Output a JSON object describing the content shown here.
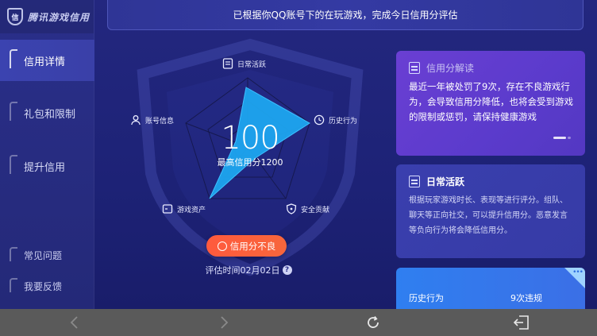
{
  "brand": {
    "name": "腾讯游戏信用",
    "logo_text": "信"
  },
  "sidebar": {
    "items": [
      {
        "label": "信用详情",
        "active": true
      },
      {
        "label": "礼包和限制",
        "active": false
      },
      {
        "label": "提升信用",
        "active": false
      }
    ],
    "bottom_items": [
      {
        "label": "常见问题"
      },
      {
        "label": "我要反馈"
      }
    ]
  },
  "banner": {
    "text": "已根据你QQ账号下的在玩游戏，完成今日信用分评估"
  },
  "radar": {
    "axes": [
      "日常活跃",
      "历史行为",
      "安全贡献",
      "游戏资产",
      "账号信息"
    ],
    "icons": [
      "doc-icon",
      "clock-icon",
      "shield-icon",
      "wallet-icon",
      "user-icon"
    ],
    "fill_color": "#1ea5ef"
  },
  "score": {
    "value": "100",
    "max_label": "最高信用分1200"
  },
  "status": {
    "label": "信用分不良",
    "color": "#ff5a3d"
  },
  "eval_time": {
    "text": "评估时间02月02日",
    "help": "?"
  },
  "cards": {
    "interpret": {
      "title": "信用分解读",
      "body": "最近一年被处罚了9次，存在不良游戏行为，会导致信用分降低，也将会受到游戏的限制或惩罚，请保持健康游戏"
    },
    "daily": {
      "title": "日常活跃",
      "body": "根据玩家游戏时长、表现等进行评分。组队、聊天等正向社交，可以提升信用分。恶意发言等负向行为将会降低信用分。"
    },
    "history": {
      "label": "历史行为",
      "value": "9次违规",
      "corner": "•••"
    }
  },
  "navbar": {
    "icons": [
      "back-arrow-icon",
      "forward-arrow-icon",
      "refresh-icon",
      "exit-icon"
    ]
  }
}
